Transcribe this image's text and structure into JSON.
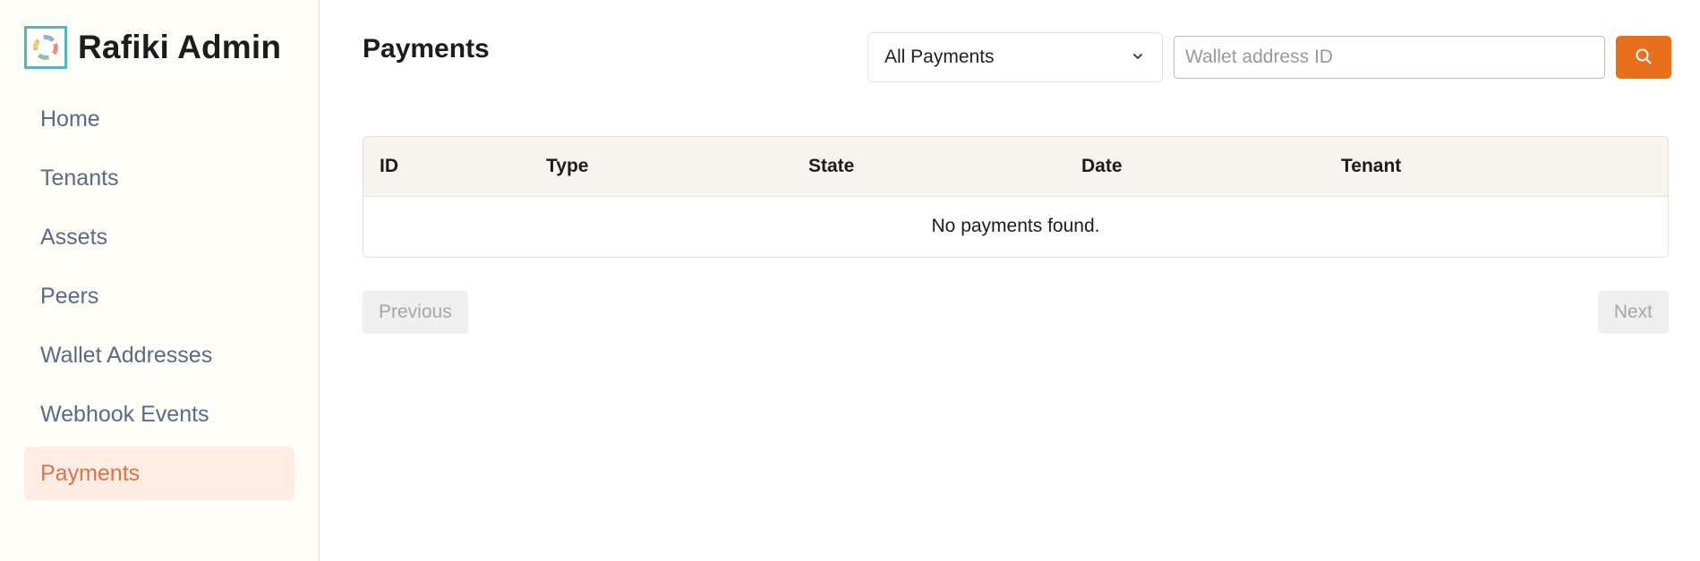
{
  "brand": {
    "title": "Rafiki Admin"
  },
  "sidebar": {
    "items": [
      {
        "label": "Home"
      },
      {
        "label": "Tenants"
      },
      {
        "label": "Assets"
      },
      {
        "label": "Peers"
      },
      {
        "label": "Wallet Addresses"
      },
      {
        "label": "Webhook Events"
      },
      {
        "label": "Payments"
      }
    ],
    "active_item": "Payments"
  },
  "main": {
    "title": "Payments",
    "filter": {
      "selected": "All Payments"
    },
    "search": {
      "placeholder": "Wallet address ID",
      "value": ""
    },
    "table": {
      "columns": [
        "ID",
        "Type",
        "State",
        "Date",
        "Tenant"
      ],
      "empty_message": "No payments found."
    },
    "pagination": {
      "previous_label": "Previous",
      "next_label": "Next"
    }
  },
  "colors": {
    "accent": "#e8701d",
    "active_nav_bg": "#fdede5",
    "active_nav_text": "#e0714a",
    "nav_text": "#5a6b87",
    "logo_border": "#56b6bc"
  }
}
